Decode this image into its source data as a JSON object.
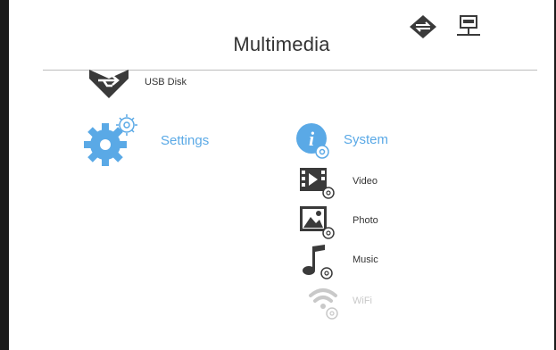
{
  "title": "Multimedia",
  "top_icons": [
    {
      "name": "usb-transfer-icon"
    },
    {
      "name": "network-icon"
    }
  ],
  "left_column": [
    {
      "label": "USB Disk",
      "icon": "usb-disk-icon"
    },
    {
      "label": "Settings",
      "icon": "settings-gear-icon",
      "selected": true
    }
  ],
  "right_column": {
    "header": {
      "label": "System",
      "icon": "system-info-icon",
      "selected": true
    },
    "items": [
      {
        "label": "Video",
        "icon": "video-settings-icon"
      },
      {
        "label": "Photo",
        "icon": "photo-settings-icon"
      },
      {
        "label": "Music",
        "icon": "music-settings-icon"
      },
      {
        "label": "WiFi",
        "icon": "wifi-settings-icon",
        "disabled": true
      }
    ]
  },
  "colors": {
    "accent": "#5aa9e6",
    "icon_dark": "#3a3a3a",
    "disabled": "#c9c9c9"
  }
}
